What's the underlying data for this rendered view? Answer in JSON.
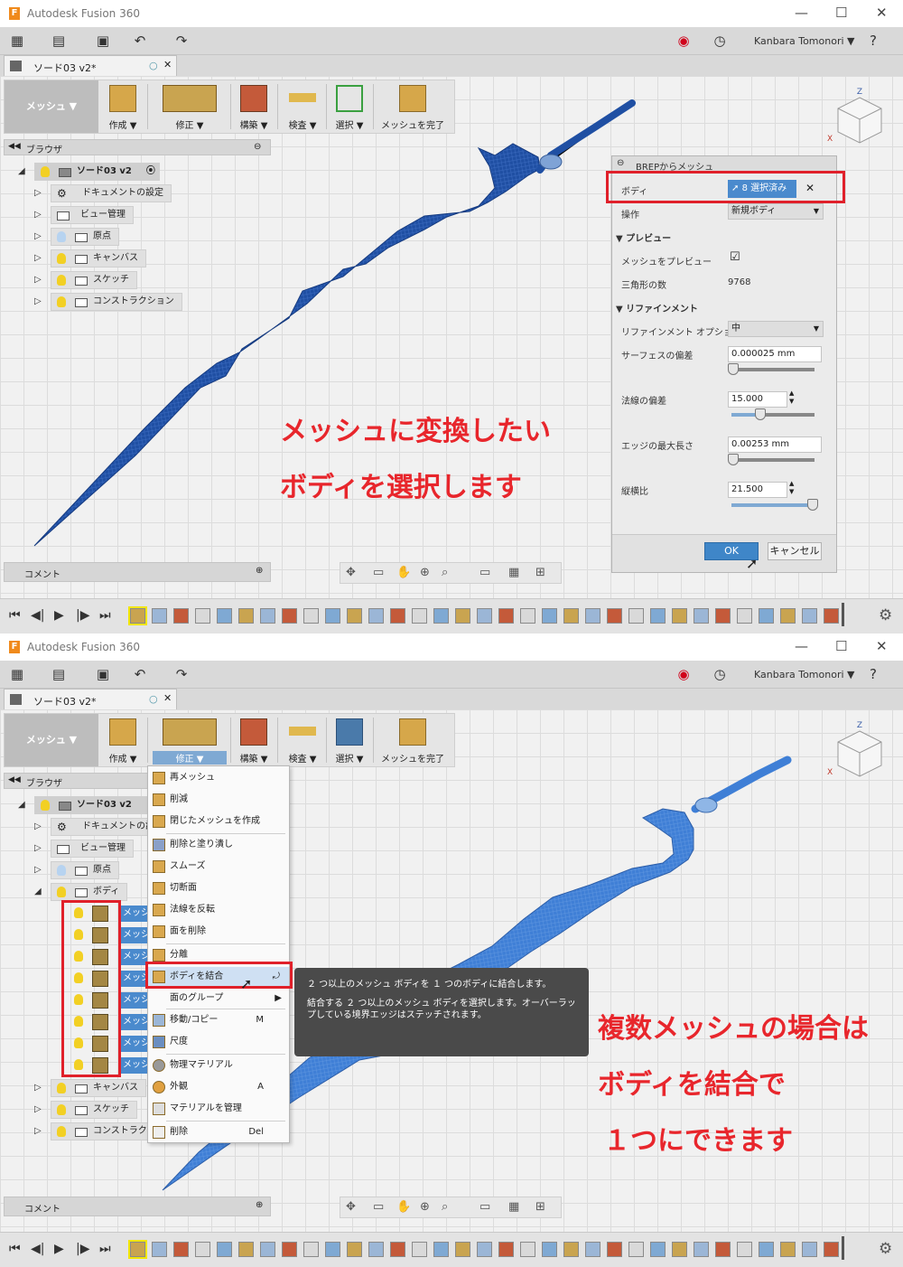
{
  "app": {
    "title": "Autodesk Fusion 360",
    "icon_letter": "F",
    "user": "Kanbara Tomonori",
    "document_tab": "ソード03 v2*",
    "window_controls": [
      "minimize-icon",
      "maximize-icon",
      "close-icon"
    ]
  },
  "toolbar": {
    "workspace": "メッシュ ▼",
    "groups": [
      "作成 ▼",
      "修正 ▼",
      "構築 ▼",
      "検査 ▼",
      "選択 ▼",
      "メッシュを完了"
    ]
  },
  "browser": {
    "header": "ブラウザ",
    "root": "ソード03 v2",
    "items_panel1": [
      "ドキュメントの設定",
      "ビュー管理",
      "原点",
      "キャンバス",
      "スケッチ",
      "コンストラクション"
    ],
    "items_panel2_top": [
      "ドキュメントの設定",
      "ビュー管理",
      "原点",
      "ボディ"
    ],
    "mesh_row_label": "メッシュ",
    "items_panel2_bottom": [
      "キャンバス",
      "スケッチ",
      "コンストラクション"
    ]
  },
  "comment_bar": "コメント",
  "brep_panel": {
    "title": "BREPからメッシュ",
    "body_label": "ボディ",
    "body_value": "8 選択済み",
    "operation_label": "操作",
    "operation_value": "新規ボディ",
    "preview_section": "▼ プレビュー",
    "mesh_preview_label": "メッシュをプレビュー",
    "mesh_preview_checked": true,
    "triangle_label": "三角形の数",
    "triangle_count": "9768",
    "refinement_section": "▼ リファインメント",
    "refinement_option_label": "リファインメント オプション",
    "refinement_option_value": "中",
    "surface_dev_label": "サーフェスの偏差",
    "surface_dev_value": "0.000025 mm",
    "normal_dev_label": "法線の偏差",
    "normal_dev_value": "15.000",
    "edge_max_label": "エッジの最大長さ",
    "edge_max_value": "0.00253 mm",
    "aspect_label": "縦横比",
    "aspect_value": "21.500",
    "ok": "OK",
    "cancel": "キャンセル"
  },
  "context_menu": {
    "items": [
      {
        "label": "再メッシュ",
        "shortcut": ""
      },
      {
        "label": "削減",
        "shortcut": ""
      },
      {
        "label": "閉じたメッシュを作成",
        "shortcut": ""
      },
      {
        "label": "削除と塗り潰し",
        "shortcut": ""
      },
      {
        "label": "スムーズ",
        "shortcut": ""
      },
      {
        "label": "切断面",
        "shortcut": ""
      },
      {
        "label": "法線を反転",
        "shortcut": ""
      },
      {
        "label": "面を削除",
        "shortcut": ""
      },
      {
        "label": "分離",
        "shortcut": ""
      },
      {
        "label": "ボディを結合",
        "shortcut": ""
      },
      {
        "label": "面のグループ",
        "shortcut": "▶"
      },
      {
        "label": "移動/コピー",
        "shortcut": "M"
      },
      {
        "label": "尺度",
        "shortcut": ""
      },
      {
        "label": "物理マテリアル",
        "shortcut": ""
      },
      {
        "label": "外観",
        "shortcut": "A"
      },
      {
        "label": "マテリアルを管理",
        "shortcut": ""
      },
      {
        "label": "削除",
        "shortcut": "Del"
      }
    ]
  },
  "tooltip": {
    "line1": "２ つ以上のメッシュ ボディを １ つのボディに結合します。",
    "line2": "結合する ２ つ以上のメッシュ ボディを選択します。オーバーラップしている境界エッジはステッチされます。"
  },
  "annotations": {
    "top_line1": "メッシュに変換したい",
    "top_line2": "ボディを選択します",
    "bottom_line1": "複数メッシュの場合は",
    "bottom_line2": "ボディを結合で",
    "bottom_line3": "１つにできます"
  },
  "colors": {
    "mesh_dark": "#1f4fa3",
    "mesh_light": "#3f7fd6",
    "annotation_red": "#e8262c",
    "highlight_blue": "#4a8acd"
  }
}
